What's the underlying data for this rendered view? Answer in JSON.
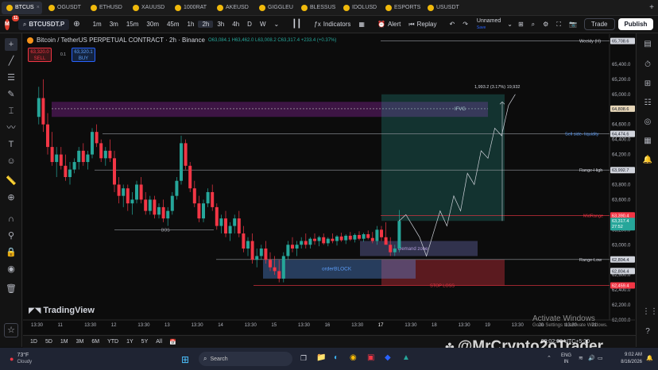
{
  "tabs": [
    {
      "label": "BTCUS",
      "active": true,
      "close": "×"
    },
    {
      "label": "OGUSDT",
      "active": false
    },
    {
      "label": "ETHUSD",
      "active": false
    },
    {
      "label": "XAUUSD",
      "active": false
    },
    {
      "label": "1000RAT",
      "active": false
    },
    {
      "label": "AKEUSD",
      "active": false
    },
    {
      "label": "GIGGLEU",
      "active": false
    },
    {
      "label": "BLESSUS",
      "active": false
    },
    {
      "label": "IDOLUSD",
      "active": false
    },
    {
      "label": "ESPORTS",
      "active": false
    },
    {
      "label": "USUSDT",
      "active": false
    }
  ],
  "toolbar": {
    "symbol": "BTCUSDT.P",
    "intervals": [
      "1m",
      "3m",
      "15m",
      "30m",
      "45m",
      "1h",
      "2h",
      "3h",
      "4h",
      "D",
      "W"
    ],
    "selected_interval": "2h",
    "indicators": "Indicators",
    "alert": "Alert",
    "replay": "Replay",
    "layout_name": "Unnamed",
    "layout_sub": "Save",
    "trade": "Trade",
    "publish": "Publish",
    "badge": "11"
  },
  "symbol_header": {
    "name": "Bitcoin / TetherUS PERPETUAL CONTRACT · 2h · Binance",
    "ohlc": "O63,084.1 H63,462.0 L63,008.2 C63,317.4 +233.4 (+0.37%)"
  },
  "order_boxes": {
    "sell_price": "63,320.0",
    "sell_label": "SELL",
    "spread": "0.1",
    "buy_price": "63,320.1",
    "buy_label": "BUY"
  },
  "price_axis": [
    "65,708.6",
    "65,400.0",
    "65,200.0",
    "65,000.0",
    "64,800.0",
    "64,600.0",
    "64,400.0",
    "64,200.0",
    "64,000.0",
    "63,800.0",
    "63,600.0",
    "63,400.0",
    "63,200.0",
    "63,000.0",
    "62,800.0",
    "62,600.0",
    "62,400.0",
    "62,200.0",
    "62,000.0"
  ],
  "price_tags": {
    "weekly_label": "Weekly (H)",
    "weekly": "65,708.6",
    "ifvg_price": "64,808.6",
    "liquidity_price": "64,474.6",
    "range_high_price": "63,992.7",
    "midrange_price": "63,390.4",
    "current": "63,317.4",
    "countdown": "27:52",
    "range_low_price": "62,804.4",
    "range_low_price2": "62,804.4",
    "stop_loss_price": "62,459.4"
  },
  "annotations": {
    "ifvg": "IFVG",
    "liquidity": "Sell side- liquidity",
    "range_high": "Range-High",
    "midrange": "MidRange",
    "range_low": "Range-Low",
    "demand": "Demand zone",
    "orderblock": "orderBLOCK",
    "stop_loss": "STOP LOSS",
    "bos": "BOS",
    "target": "1,993.2 (3.17%) 19,932"
  },
  "time_axis": [
    "13:30",
    "11",
    "13:30",
    "12",
    "13:30",
    "13",
    "13:30",
    "14",
    "13:30",
    "15",
    "13:30",
    "16",
    "13:30",
    "17",
    "13:30",
    "18",
    "13:30",
    "19",
    "13:30",
    "20",
    "13:30",
    "21"
  ],
  "timeframes": [
    "1D",
    "5D",
    "1M",
    "3M",
    "6M",
    "YTD",
    "1Y",
    "5Y",
    "All"
  ],
  "status_time": "09:02:08 UTC+5:30",
  "watermark": "TradingView",
  "activate": {
    "title": "Activate Windows",
    "sub": "Go to Settings to activate Windows."
  },
  "overlay_brand": "@MrCrypto2oTrader",
  "taskbar": {
    "weather_temp": "73°F",
    "weather_desc": "Cloudy",
    "search": "Search",
    "lang": "ENG",
    "region": "IN",
    "time": "9:02 AM",
    "date": "8/16/2026"
  },
  "chart_data": {
    "type": "candlestick",
    "interval": "2h",
    "ylim": [
      62000,
      65800
    ],
    "candles": [
      [
        64700,
        65100,
        64600,
        64950
      ],
      [
        64950,
        65200,
        64500,
        64600
      ],
      [
        64600,
        64750,
        64200,
        64300
      ],
      [
        64300,
        64500,
        64050,
        64100
      ],
      [
        64100,
        64300,
        63900,
        64200
      ],
      [
        64200,
        64300,
        64000,
        64050
      ],
      [
        64050,
        64200,
        63850,
        63900
      ],
      [
        63900,
        64100,
        63800,
        64000
      ],
      [
        64000,
        64150,
        63950,
        64100
      ],
      [
        64100,
        64300,
        64000,
        64250
      ],
      [
        64250,
        64350,
        64050,
        64100
      ],
      [
        64100,
        64250,
        64000,
        64200
      ],
      [
        64200,
        64550,
        64150,
        64500
      ],
      [
        64500,
        64600,
        64300,
        64350
      ],
      [
        64350,
        64400,
        64100,
        64150
      ],
      [
        64150,
        64300,
        64050,
        64250
      ],
      [
        64250,
        64400,
        64100,
        64150
      ],
      [
        64150,
        64250,
        63700,
        63800
      ],
      [
        63800,
        63900,
        63550,
        63650
      ],
      [
        63650,
        63800,
        63500,
        63750
      ],
      [
        63750,
        63800,
        63450,
        63550
      ],
      [
        63550,
        63700,
        63400,
        63600
      ],
      [
        63600,
        63850,
        63550,
        63800
      ],
      [
        63800,
        63900,
        63550,
        63600
      ],
      [
        63600,
        63700,
        63400,
        63450
      ],
      [
        63450,
        63650,
        63400,
        63600
      ],
      [
        63600,
        63650,
        63350,
        63400
      ],
      [
        63400,
        63550,
        63350,
        63500
      ],
      [
        63500,
        63600,
        63300,
        63350
      ],
      [
        63350,
        63500,
        63250,
        63450
      ],
      [
        63450,
        63700,
        63400,
        63650
      ],
      [
        63650,
        63900,
        63600,
        63850
      ],
      [
        63850,
        64450,
        63800,
        64350
      ],
      [
        64350,
        64400,
        64000,
        64050
      ],
      [
        64050,
        64100,
        63700,
        63750
      ],
      [
        63750,
        63850,
        63500,
        63550
      ],
      [
        63550,
        63650,
        63300,
        63350
      ],
      [
        63350,
        63600,
        63300,
        63550
      ],
      [
        63550,
        63750,
        63500,
        63700
      ],
      [
        63700,
        63800,
        63450,
        63500
      ],
      [
        63500,
        63550,
        63200,
        63250
      ],
      [
        63250,
        63400,
        63150,
        63350
      ],
      [
        63350,
        63450,
        63100,
        63150
      ],
      [
        63150,
        63300,
        63050,
        63250
      ],
      [
        63250,
        63400,
        63150,
        63350
      ],
      [
        63350,
        63450,
        63100,
        63150
      ],
      [
        63150,
        63250,
        62900,
        62950
      ],
      [
        62950,
        63100,
        62850,
        63050
      ],
      [
        63050,
        63150,
        62750,
        62800
      ],
      [
        62800,
        62950,
        62700,
        62850
      ],
      [
        62850,
        63000,
        62800,
        62950
      ],
      [
        62950,
        63050,
        62750,
        62800
      ],
      [
        62800,
        62900,
        62650,
        62700
      ],
      [
        62700,
        62850,
        62600,
        62650
      ],
      [
        62650,
        62800,
        62500,
        62550
      ],
      [
        62550,
        62900,
        62500,
        62850
      ],
      [
        62850,
        63050,
        62800,
        63000
      ],
      [
        63000,
        63100,
        62900,
        62950
      ],
      [
        62950,
        63050,
        62850,
        63000
      ],
      [
        63000,
        63100,
        62950,
        63050
      ],
      [
        63050,
        63150,
        62950,
        63000
      ],
      [
        63000,
        63100,
        62950,
        63080
      ],
      [
        63080,
        63150,
        63000,
        63050
      ],
      [
        63050,
        63120,
        62980,
        63100
      ],
      [
        63100,
        63150,
        63000,
        63020
      ],
      [
        63020,
        63100,
        62980,
        63080
      ],
      [
        63080,
        63150,
        63020,
        63050
      ],
      [
        63050,
        63130,
        62990,
        63110
      ],
      [
        63110,
        63160,
        63040,
        63060
      ],
      [
        63060,
        63140,
        63010,
        63120
      ],
      [
        63120,
        63170,
        63050,
        63070
      ],
      [
        63070,
        63150,
        63030,
        63130
      ],
      [
        63130,
        63180,
        63060,
        63080
      ],
      [
        63080,
        63160,
        63040,
        63140
      ],
      [
        63140,
        63190,
        63070,
        63090
      ],
      [
        63090,
        63170,
        63020,
        63050
      ],
      [
        63050,
        63250,
        63000,
        63200
      ],
      [
        63200,
        63250,
        63050,
        63100
      ],
      [
        63100,
        63300,
        63050,
        63000
      ],
      [
        63000,
        63100,
        62850,
        62900
      ],
      [
        62900,
        63000,
        62850,
        62950
      ],
      [
        62950,
        63462,
        62900,
        63317
      ]
    ],
    "projection": [
      [
        63317,
        63400
      ],
      [
        63400,
        63250
      ],
      [
        63250,
        63100
      ],
      [
        63100,
        62850
      ],
      [
        62850,
        63150
      ],
      [
        63150,
        63450
      ],
      [
        63450,
        63250
      ],
      [
        63250,
        63650
      ],
      [
        63650,
        63450
      ],
      [
        63450,
        63950
      ],
      [
        63950,
        63800
      ],
      [
        63800,
        64250
      ],
      [
        64250,
        64150
      ],
      [
        64150,
        64550
      ],
      [
        64550,
        64450
      ],
      [
        64450,
        64850
      ],
      [
        64850,
        65000
      ]
    ]
  }
}
